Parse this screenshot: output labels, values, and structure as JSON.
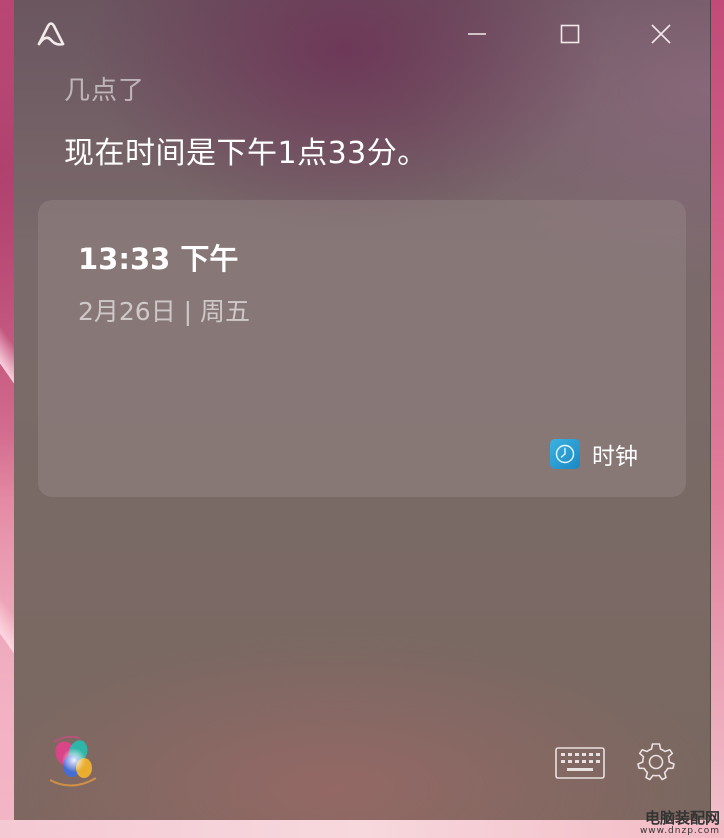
{
  "titlebar": {
    "app_icon": "cortana-a-logo-icon",
    "minimize_icon": "minimize-icon",
    "maximize_icon": "maximize-icon",
    "close_icon": "close-icon"
  },
  "conversation": {
    "query": "几点了",
    "answer": "现在时间是下午1点33分。"
  },
  "clock_card": {
    "time": "13:33 下午",
    "date": "2月26日 | 周五",
    "source_icon": "clock-app-icon",
    "source_label": "时钟"
  },
  "bottom_bar": {
    "assistant_icon": "cortana-orb-icon",
    "keyboard_icon": "keyboard-icon",
    "settings_icon": "settings-gear-icon"
  },
  "watermark": {
    "main": "电脑装配网",
    "sub": "www.dnzp.com"
  },
  "colors": {
    "window_tint": "#7a6a6b",
    "card_bg": "#8a7b7a",
    "clock_icon_blue": "#2a9ed6",
    "desktop_pink": "#c24a78"
  }
}
